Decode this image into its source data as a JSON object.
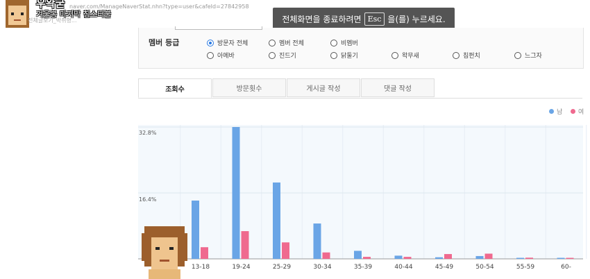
{
  "overlay": {
    "streamer_name": "우왁굳",
    "stream_title": "겨울봉 마지막 침스터불",
    "url_text": "naver.com/ManageNaverStat.nhn?type=user&cafeId=27842958",
    "sub_text": "전체글보기_박쥐형..."
  },
  "fullscreen_notice": {
    "prefix": "전체화면을 종료하려면",
    "key": "Esc",
    "suffix": "을(를) 누르세요."
  },
  "filter": {
    "label": "멤버 등급",
    "options": [
      {
        "label": "방문자 전체",
        "selected": true
      },
      {
        "label": "멤버 전체",
        "selected": false
      },
      {
        "label": "비멤버",
        "selected": false
      },
      {
        "label": "아메바",
        "selected": false
      },
      {
        "label": "진드기",
        "selected": false
      },
      {
        "label": "닭둘기",
        "selected": false
      },
      {
        "label": "왁무새",
        "selected": false
      },
      {
        "label": "침펀치",
        "selected": false
      },
      {
        "label": "느그자",
        "selected": false
      }
    ]
  },
  "tabs": [
    {
      "label": "조회수",
      "active": true
    },
    {
      "label": "방문횟수",
      "active": false
    },
    {
      "label": "게시글 작성",
      "active": false
    },
    {
      "label": "댓글 작성",
      "active": false
    }
  ],
  "legend": [
    {
      "label": "남",
      "color": "#6aa5e6"
    },
    {
      "label": "여",
      "color": "#ef6a8f"
    }
  ],
  "chart_data": {
    "type": "bar",
    "categories": [
      "13-18",
      "19-24",
      "25-29",
      "30-34",
      "35-39",
      "40-44",
      "45-49",
      "50-54",
      "55-59",
      "60-"
    ],
    "series": [
      {
        "name": "남",
        "color": "#6aa5e6",
        "values": [
          14.5,
          32.8,
          19.0,
          8.8,
          2.0,
          0.8,
          0.4,
          0.7,
          0.2,
          0.1
        ]
      },
      {
        "name": "여",
        "color": "#ef6a8f",
        "values": [
          2.9,
          6.9,
          4.1,
          1.6,
          0.5,
          0.5,
          1.2,
          1.3,
          0.3,
          0.2
        ]
      }
    ],
    "yticks": [
      "32.8%",
      "16.4%"
    ],
    "ylim": [
      0,
      32.8
    ],
    "grid": true
  }
}
